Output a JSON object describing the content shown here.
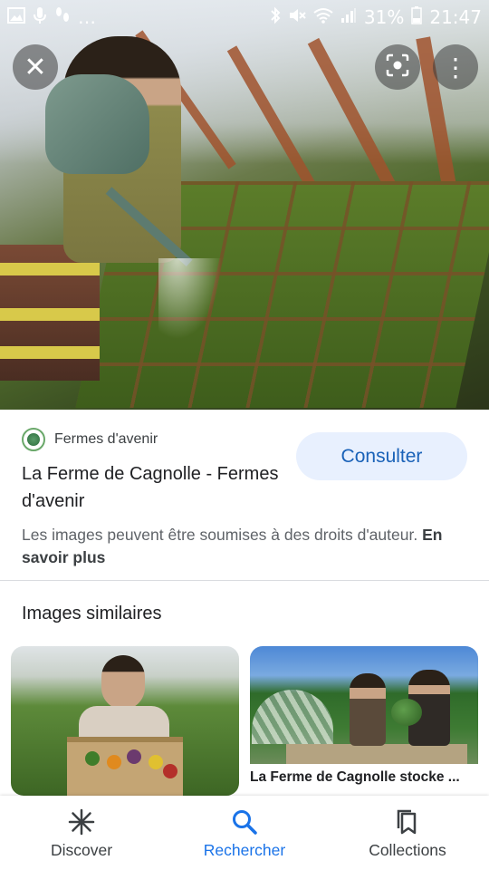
{
  "status_bar": {
    "battery": "31%",
    "time": "21:47",
    "left_icons": [
      "image-notification-icon",
      "mic-notification-icon",
      "footprints-notification-icon",
      "more-notifications-icon"
    ],
    "right_icons": [
      "bluetooth-icon",
      "mute-icon",
      "wifi-icon",
      "signal-icon",
      "battery-icon"
    ]
  },
  "hero": {
    "buttons": [
      "close-icon",
      "lens-icon",
      "more-vert-icon"
    ]
  },
  "result": {
    "source_name": "Fermes d'avenir",
    "title": "La Ferme de Cagnolle - Fermes d'avenir",
    "consult_label": "Consulter",
    "rights_text": "Les images peuvent être soumises à des droits d'auteur.",
    "rights_link": "En savoir plus"
  },
  "similar": {
    "heading": "Images similaires",
    "items": [
      {
        "caption": ""
      },
      {
        "caption": "La Ferme de Cagnolle stocke ..."
      }
    ]
  },
  "bottom_nav": {
    "items": [
      {
        "label": "Discover",
        "icon": "asterisk-icon",
        "active": false
      },
      {
        "label": "Rechercher",
        "icon": "search-icon",
        "active": true
      },
      {
        "label": "Collections",
        "icon": "collections-icon",
        "active": false
      }
    ]
  },
  "colors": {
    "accent": "#1a73e8",
    "consult_bg": "#e8f0fe",
    "consult_text": "#1a62b8"
  }
}
